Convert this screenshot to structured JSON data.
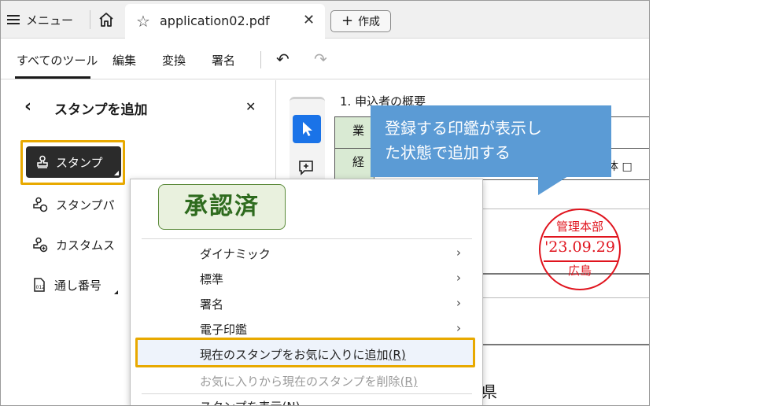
{
  "tabbar": {
    "menu_label": "メニュー",
    "tab_title": "application02.pdf",
    "create_label": "作成"
  },
  "toolbar": {
    "all_tools": "すべてのツール",
    "edit": "編集",
    "convert": "変換",
    "sign": "署名"
  },
  "panel": {
    "title": "スタンプを追加",
    "stamp_button": "スタンプ",
    "items": [
      "スタンプパ",
      "カスタムス",
      "通し番号"
    ]
  },
  "document": {
    "heading": "1. 申込者の概要",
    "table_cells": [
      "業",
      "経"
    ],
    "table_tail": "体 □",
    "bottom_text": "島県",
    "seal": {
      "line1": "管理本部",
      "line2": "'23.09.29",
      "line3": "広島",
      "color": "#e0141e"
    }
  },
  "callout": {
    "line1": "登録する印鑑が表示し",
    "line2": "た状態で追加する"
  },
  "dropdown": {
    "stamp_preview": "承認済",
    "items": [
      "ダイナミック",
      "標準",
      "署名",
      "電子印鑑"
    ],
    "add_favorite": "現在のスタンプをお気に入りに追加",
    "add_favorite_key": "(R)",
    "remove_favorite": "お気に入りから現在のスタンプを削除",
    "remove_favorite_key": "(R)",
    "show_stamp": "スタンプを表示(N)"
  },
  "colors": {
    "highlight": "#e8a900",
    "callout": "#5b9bd5",
    "selected_tool": "#1a73e8",
    "stamp_green": "#2e6b1e"
  }
}
